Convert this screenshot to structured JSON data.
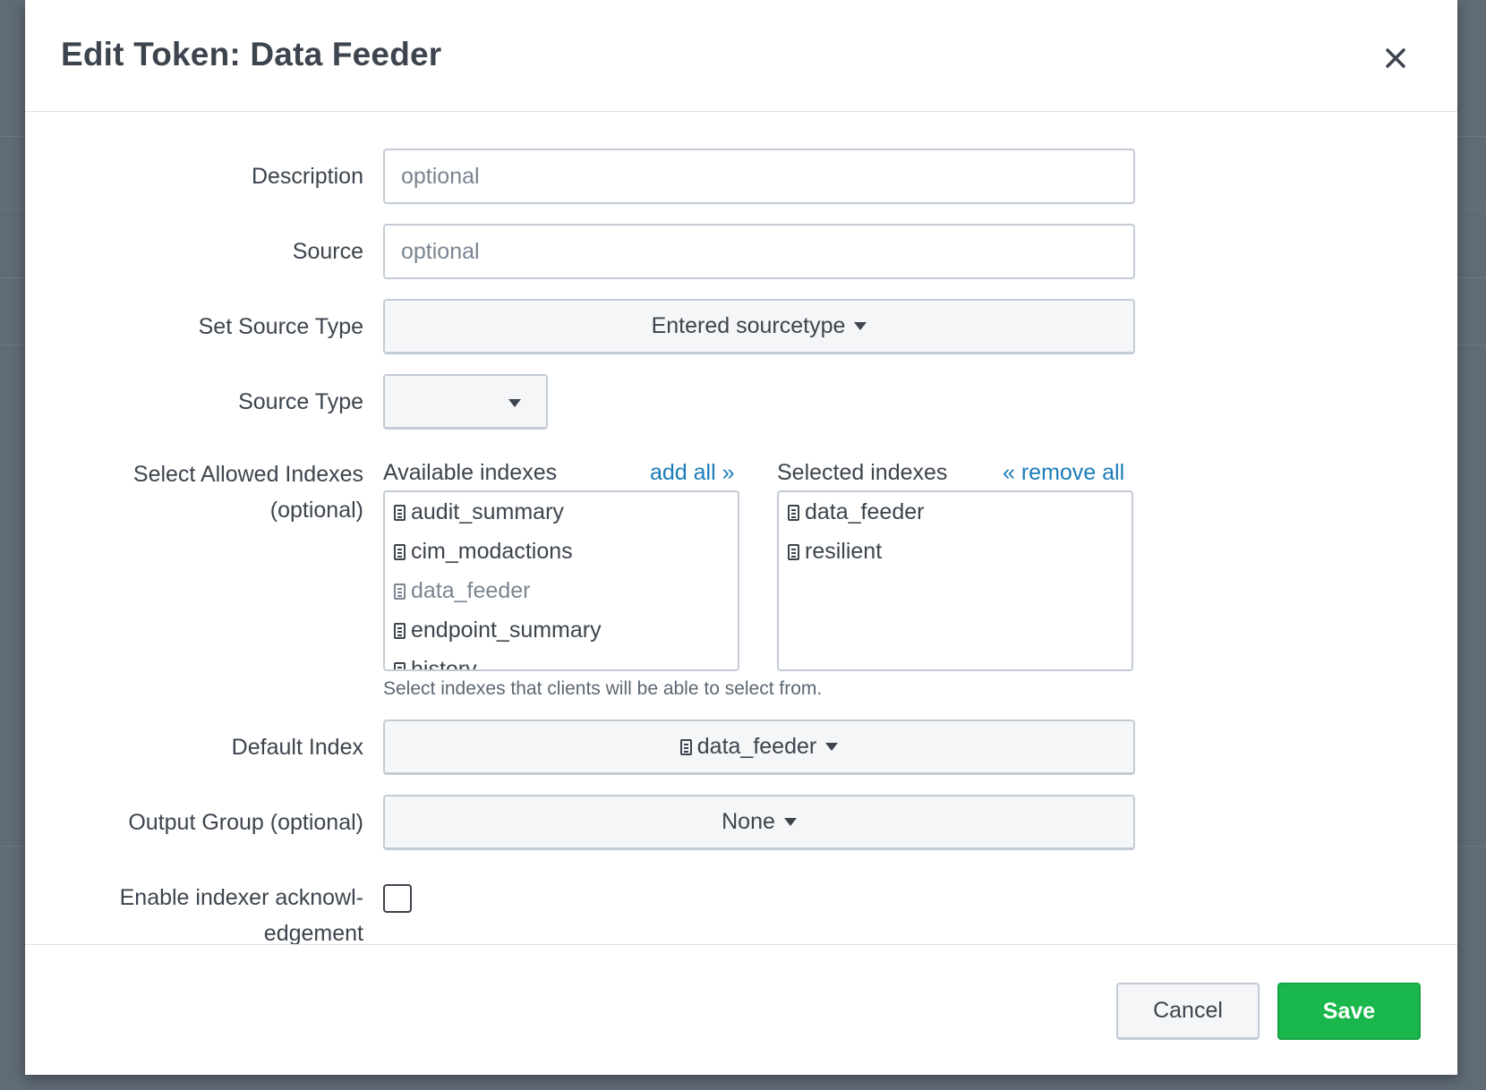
{
  "modal": {
    "title": "Edit Token: Data Feeder"
  },
  "form": {
    "description": {
      "label": "Description",
      "placeholder": "optional",
      "value": ""
    },
    "source": {
      "label": "Source",
      "placeholder": "optional",
      "value": ""
    },
    "set_source_type": {
      "label": "Set Source Type",
      "value": "Entered sourcetype"
    },
    "source_type": {
      "label": "Source Type",
      "value": ""
    },
    "allowed_indexes": {
      "label_line1": "Select Allowed Indexes",
      "label_line2": "(optional)",
      "available_header": "Available indexes",
      "add_all": "add all »",
      "selected_header": "Selected indexes",
      "remove_all": "« remove all",
      "available": [
        {
          "name": "audit_summary",
          "muted": false
        },
        {
          "name": "cim_modactions",
          "muted": false
        },
        {
          "name": "data_feeder",
          "muted": true
        },
        {
          "name": "endpoint_summary",
          "muted": false
        },
        {
          "name": "history",
          "muted": false
        }
      ],
      "selected": [
        {
          "name": "data_feeder"
        },
        {
          "name": "resilient"
        }
      ],
      "help": "Select indexes that clients will be able to select from."
    },
    "default_index": {
      "label": "Default Index",
      "value": "data_feeder"
    },
    "output_group": {
      "label": "Output Group (optional)",
      "value": "None"
    },
    "indexer_ack": {
      "label_line1": "Enable indexer acknowl-",
      "label_line2": "edgement",
      "checked": false
    }
  },
  "footer": {
    "cancel_label": "Cancel",
    "save_label": "Save"
  },
  "icons": {
    "close": "close-icon",
    "index": "index-icon",
    "caret": "caret-down-icon"
  },
  "colors": {
    "link": "#1a7cb8",
    "save": "#1ab84c",
    "text": "#3c444d"
  }
}
